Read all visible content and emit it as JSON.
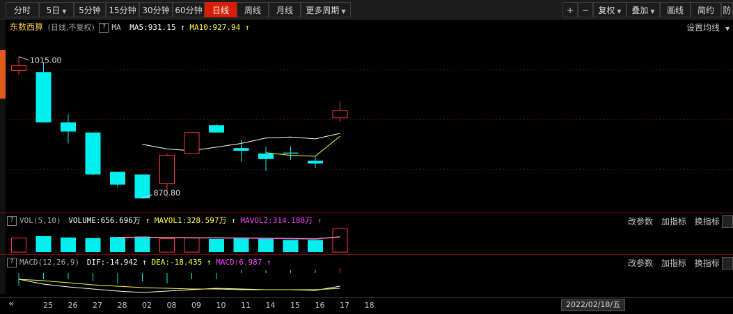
{
  "toolbar": {
    "periods": [
      "分时",
      "5日",
      "5分钟",
      "15分钟",
      "30分钟",
      "60分钟",
      "日线",
      "周线",
      "月线",
      "更多周期"
    ],
    "active_index": 6,
    "right_buttons": [
      "+",
      "−",
      "复权",
      "叠加",
      "画线",
      "简约",
      "防"
    ]
  },
  "price_panel": {
    "name": "东数西算",
    "mode": "(日线,不复权)",
    "indicator": "MA",
    "ma5": "MA5:931.15",
    "ma10": "MA10:927.94",
    "settings_label": "设置均线",
    "high_label": "1015.00",
    "low_label": "870.80"
  },
  "vol_panel": {
    "name": "VOL(5,10)",
    "volume": "VOLUME:656.696万",
    "mavol1": "MAVOL1:328.597万",
    "mavol2": "MAVOL2:314.188万",
    "tools": [
      "改参数",
      "加指标",
      "换指标"
    ]
  },
  "macd_panel": {
    "name": "MACD(12,26,9)",
    "dif": "DIF:-14.942",
    "dea": "DEA:-18.435",
    "macd": "MACD:6.987",
    "tools": [
      "改参数",
      "加指标",
      "换指标"
    ]
  },
  "xaxis": {
    "nav": "«",
    "labels": [
      "25",
      "26",
      "27",
      "28",
      "02",
      "08",
      "09",
      "10",
      "11",
      "14",
      "15",
      "16",
      "17",
      "18"
    ],
    "current_date": "2022/02/18/五"
  },
  "colors": {
    "up": "#ff3b3b",
    "down": "#00f0f0",
    "ma5": "#ffffff",
    "ma10": "#ffff44",
    "mavol2": "#ff44ff"
  },
  "chart_data": {
    "type": "candlestick",
    "x": [
      "25",
      "26",
      "27",
      "28",
      "02",
      "08",
      "09",
      "10",
      "11",
      "14",
      "15",
      "16",
      "17",
      "18"
    ],
    "candles": [
      {
        "o": 1000,
        "c": 1005,
        "h": 1015,
        "l": 995
      },
      {
        "o": 998,
        "c": 943,
        "h": 1009,
        "l": 943
      },
      {
        "o": 943,
        "c": 933,
        "h": 952,
        "l": 920
      },
      {
        "o": 932,
        "c": 886,
        "h": 932,
        "l": 885
      },
      {
        "o": 889,
        "c": 875,
        "h": 889,
        "l": 872
      },
      {
        "o": 886,
        "c": 860,
        "h": 886,
        "l": 860
      },
      {
        "o": 876,
        "c": 907,
        "h": 909,
        "l": 861
      },
      {
        "o": 909,
        "c": 932,
        "h": 932,
        "l": 909
      },
      {
        "o": 940,
        "c": 932,
        "h": 941,
        "l": 932
      },
      {
        "o": 915,
        "c": 912,
        "h": 924,
        "l": 900
      },
      {
        "o": 909,
        "c": 903,
        "h": 916,
        "l": 890
      },
      {
        "o": 910,
        "c": 909,
        "h": 917,
        "l": 902
      },
      {
        "o": 901,
        "c": 898,
        "h": 907,
        "l": 893
      },
      {
        "o": 948,
        "c": 956,
        "h": 966,
        "l": 944
      }
    ],
    "ma5": [
      null,
      null,
      null,
      null,
      null,
      919,
      914,
      912,
      916,
      920,
      926,
      927,
      925,
      931
    ],
    "ma10": [
      null,
      null,
      null,
      null,
      null,
      null,
      null,
      null,
      null,
      null,
      910,
      907,
      906,
      928
    ],
    "volume": [
      60,
      68,
      62,
      60,
      64,
      66,
      58,
      60,
      56,
      62,
      60,
      52,
      52,
      100
    ],
    "macd": [
      6,
      3,
      3,
      4,
      5,
      4,
      5,
      3,
      3,
      4,
      4,
      4,
      4,
      7
    ],
    "dif": [
      -5,
      -12,
      -16,
      -19,
      -22,
      -24,
      -22,
      -20,
      -18,
      -19,
      -20,
      -20,
      -21,
      -15
    ],
    "dea": [
      -5,
      -7,
      -10,
      -13,
      -15,
      -17,
      -18,
      -19,
      -19,
      -20,
      -20,
      -20,
      -20,
      -18
    ]
  }
}
